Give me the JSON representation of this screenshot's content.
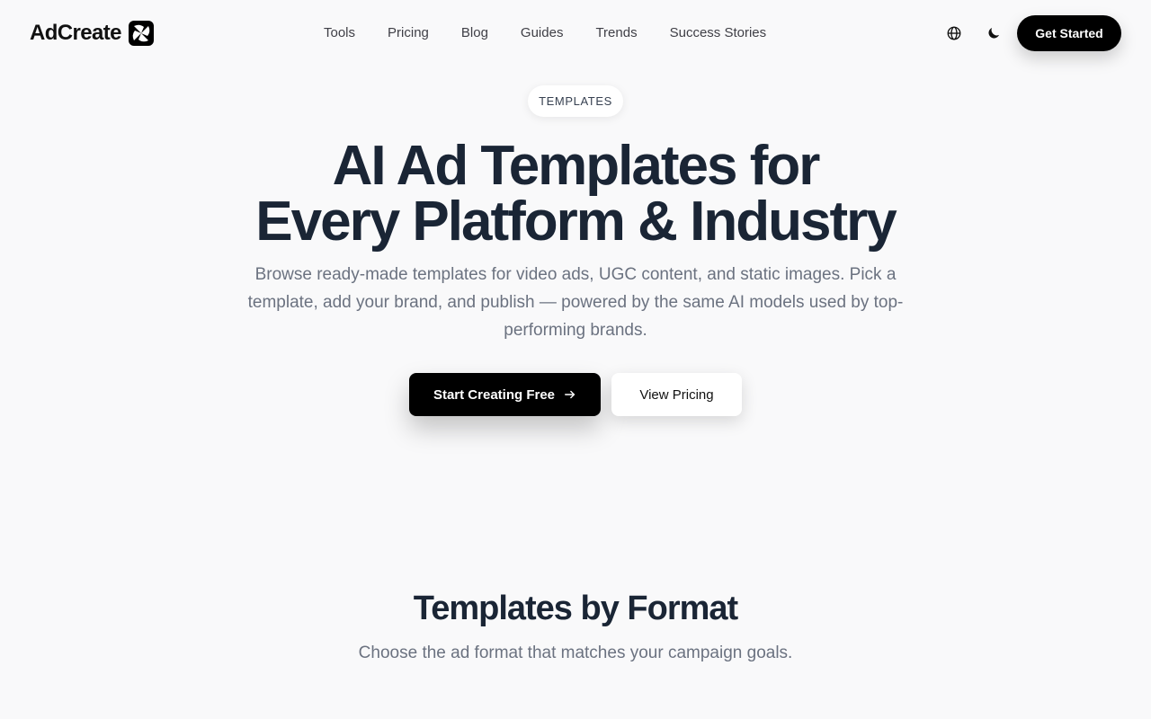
{
  "header": {
    "logo_text": "AdCreate",
    "logo_icon": "four-blades-logo-icon",
    "nav": [
      {
        "label": "Tools"
      },
      {
        "label": "Pricing"
      },
      {
        "label": "Blog"
      },
      {
        "label": "Guides"
      },
      {
        "label": "Trends"
      },
      {
        "label": "Success Stories"
      }
    ],
    "language_icon": "globe-icon",
    "theme_icon": "moon-icon",
    "cta_label": "Get Started"
  },
  "hero": {
    "badge": "TEMPLATES",
    "title_line1": "AI Ad Templates for",
    "title_line2": "Every Platform & Industry",
    "subtitle": "Browse ready-made templates for video ads, UGC content, and static images. Pick a template, add your brand, and publish — powered by the same AI models used by top-performing brands.",
    "primary_label": "Start Creating Free",
    "primary_icon": "arrow-right-icon",
    "secondary_label": "View Pricing"
  },
  "section": {
    "title": "Templates by Format",
    "subtitle": "Choose the ad format that matches your campaign goals."
  },
  "colors": {
    "background": "#f9f9fa",
    "accent": "#000000",
    "heading": "#1a2535",
    "muted": "#6b7280"
  }
}
